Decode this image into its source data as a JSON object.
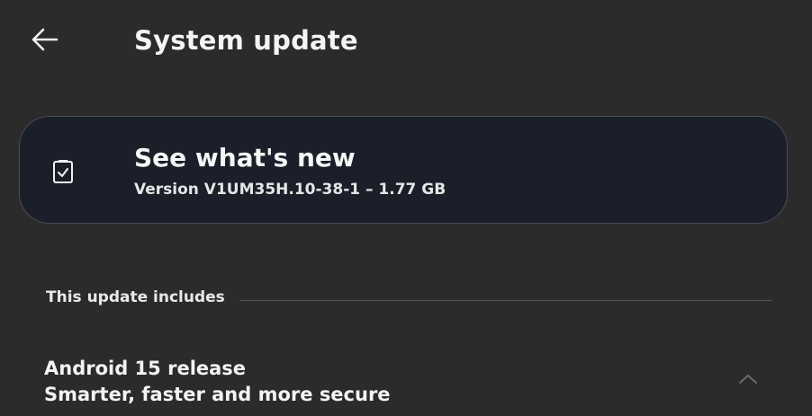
{
  "header": {
    "title": "System update",
    "back_icon": "arrow-left-icon"
  },
  "update_card": {
    "icon": "checklist-clipboard-icon",
    "title": "See what's new",
    "subtitle": "Version V1UM35H.10-38-1 – 1.77 GB",
    "background_color": "#1a1f29"
  },
  "section": {
    "label": "This update includes"
  },
  "release": {
    "title": "Android 15 release",
    "subtitle": "Smarter, faster and more secure",
    "expand_icon": "chevron-up-icon"
  }
}
